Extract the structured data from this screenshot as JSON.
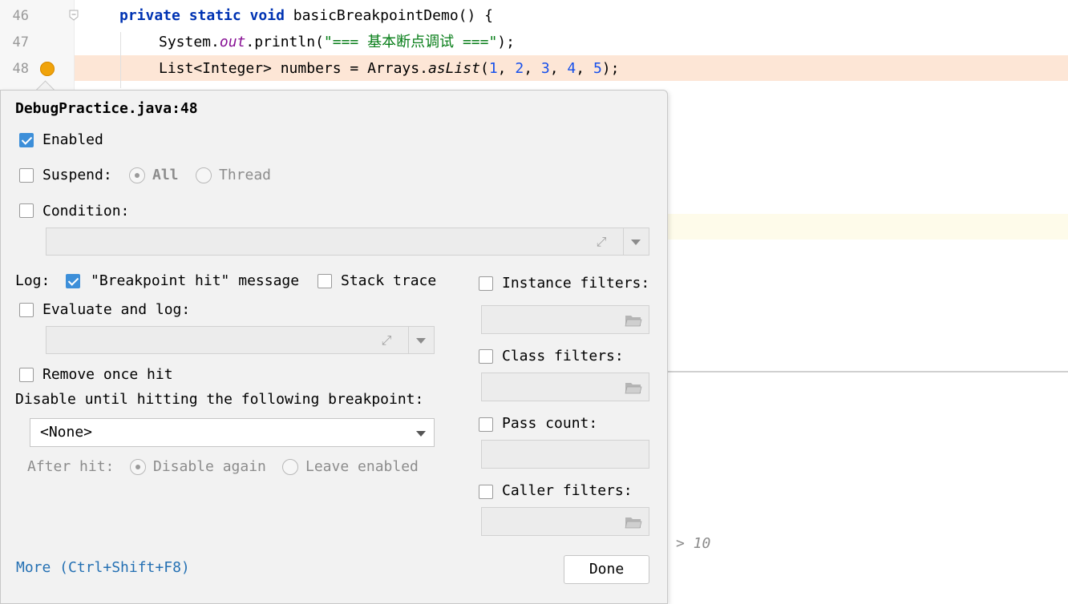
{
  "editor": {
    "line_numbers": [
      "46",
      "47",
      "48"
    ],
    "line46": {
      "kw": "private static void ",
      "text": "basicBreakpointDemo() {"
    },
    "line47": {
      "a": "System.",
      "field": "out",
      "b": ".println(",
      "str": "\"=== 基本断点调试 ===\"",
      "c": ");"
    },
    "line48": {
      "a": "List<Integer> numbers = Arrays.",
      "method": "asList",
      "b": "(",
      "n1": "1",
      "n2": "2",
      "n3": "3",
      "n4": "4",
      "n5": "5",
      "c": ");",
      "sep": ", "
    },
    "hint": "> 10",
    "colors": {
      "breakpoint": "#f0a30a",
      "current_line": "#fde6d6"
    }
  },
  "popup": {
    "title": "DebugPractice.java:48",
    "enabled": {
      "label": "Enabled",
      "checked": true
    },
    "suspend": {
      "label": "Suspend:",
      "checked": false,
      "options": [
        "All",
        "Thread"
      ],
      "selected": "All"
    },
    "condition": {
      "label": "Condition:",
      "checked": false,
      "value": ""
    },
    "log": {
      "label": "Log:",
      "breakpoint_hit": {
        "label": "\"Breakpoint hit\" message",
        "checked": true
      },
      "stack_trace": {
        "label": "Stack trace",
        "checked": false
      }
    },
    "evaluate_and_log": {
      "label": "Evaluate and log:",
      "checked": false,
      "value": ""
    },
    "remove_once_hit": {
      "label": "Remove once hit",
      "checked": false
    },
    "disable_until": {
      "label": "Disable until hitting the following breakpoint:",
      "selected": "<None>"
    },
    "after_hit": {
      "label": "After hit:",
      "options": [
        "Disable again",
        "Leave enabled"
      ],
      "selected": "Disable again"
    },
    "instance_filters": {
      "label": "Instance filters:",
      "checked": false
    },
    "class_filters": {
      "label": "Class filters:",
      "checked": false
    },
    "pass_count": {
      "label": "Pass count:",
      "checked": false
    },
    "caller_filters": {
      "label": "Caller filters:",
      "checked": false
    },
    "more_link": "More (Ctrl+Shift+F8)",
    "done_button": "Done",
    "colors": {
      "checkbox_checked": "#3d8fd9",
      "link": "#2470b3"
    }
  }
}
